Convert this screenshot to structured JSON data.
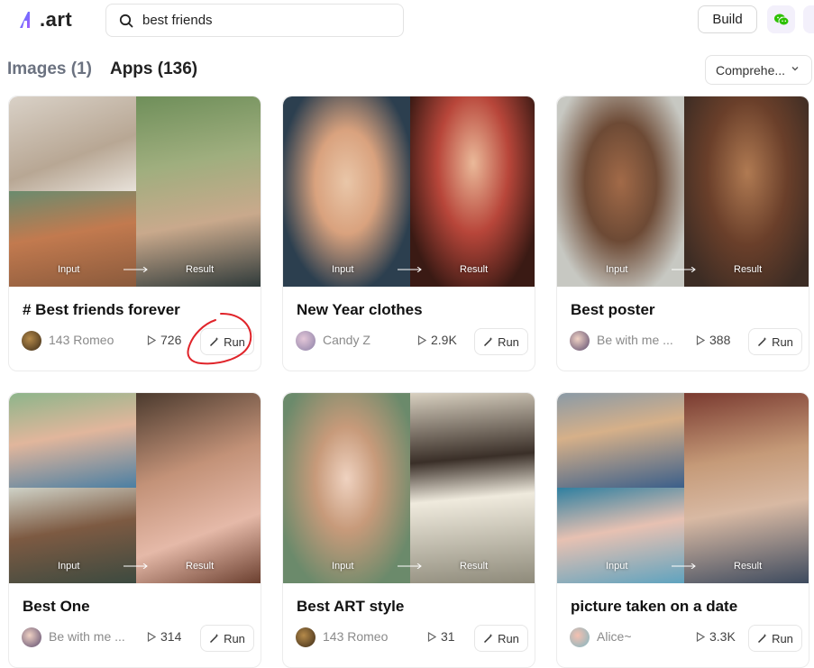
{
  "header": {
    "logo_text": ".art",
    "search_value": "best friends",
    "build_label": "Build"
  },
  "tabs": [
    {
      "label": "Images (1)"
    },
    {
      "label": "Apps (136)"
    }
  ],
  "sort": {
    "selected": "Comprehe..."
  },
  "image_labels": {
    "input": "Input",
    "result": "Result"
  },
  "run_label": "Run",
  "cards": [
    {
      "title": "# Best friends forever",
      "author": "143 Romeo",
      "count": "726"
    },
    {
      "title": "New Year clothes",
      "author": "Candy Z",
      "count": "2.9K"
    },
    {
      "title": "Best poster",
      "author": "Be with me ...",
      "count": "388"
    },
    {
      "title": "Best One",
      "author": "Be with me ...",
      "count": "314"
    },
    {
      "title": "Best ART style",
      "author": "143 Romeo",
      "count": "31"
    },
    {
      "title": "picture taken on a date",
      "author": "Alice~",
      "count": "3.3K"
    }
  ],
  "colors": {
    "accent": "#7c5cff",
    "wechat": "#2dc100",
    "annotation": "#e0242a"
  }
}
